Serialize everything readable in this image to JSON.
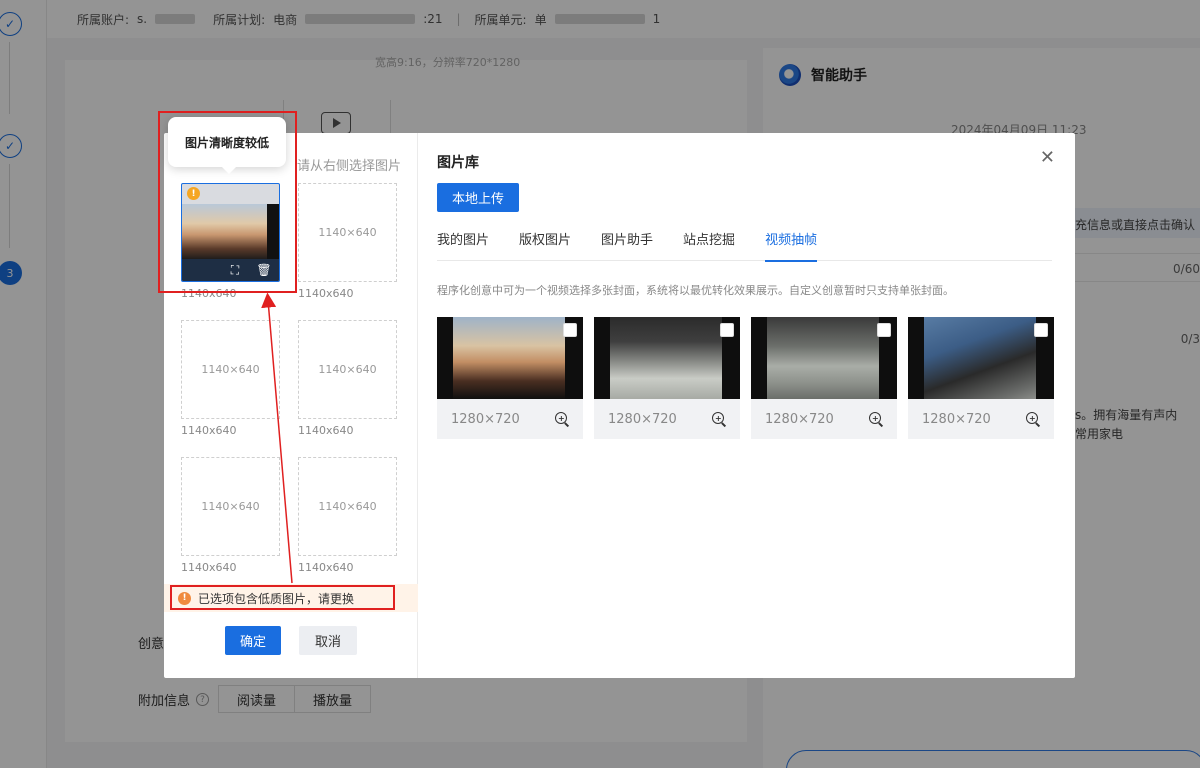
{
  "background": {
    "account_label": "所属账户:",
    "account_value": "s.",
    "plan_label": "所属计划:",
    "plan_value": "电商",
    "plan_suffix": ":21",
    "unit_label": "所属单元:",
    "unit_value": "单",
    "unit_suffix": "1",
    "video_info": "宽高9:16，分辨率720*1280",
    "step_3": "3",
    "creative_label": "创意",
    "extra_label": "附加信息",
    "extra_tags": [
      "阅读量",
      "播放量"
    ],
    "assistant_title": "智能助手",
    "assistant_date": "2024年04月09日 11:23",
    "assistant_hint": "充信息或直接点击确认",
    "assistant_counts": [
      "0/60",
      "0/3"
    ],
    "assistant_text_1": "s。拥有海量有声内",
    "assistant_text_2": "常用家电"
  },
  "left_pane": {
    "hint": "请从右侧选择图片",
    "tooltip": "图片清晰度较低",
    "slots": [
      {
        "label": "",
        "caption": "1140x640",
        "filled": true
      },
      {
        "label": "1140×640",
        "caption": "1140x640",
        "filled": false
      },
      {
        "label": "1140×640",
        "caption": "1140x640",
        "filled": false
      },
      {
        "label": "1140×640",
        "caption": "1140x640",
        "filled": false
      },
      {
        "label": "1140×640",
        "caption": "1140x640",
        "filled": false
      },
      {
        "label": "1140×640",
        "caption": "1140x640",
        "filled": false
      }
    ],
    "warning": "已选项包含低质图片，请更换",
    "confirm": "确定",
    "cancel": "取消"
  },
  "right_pane": {
    "title": "图片库",
    "upload": "本地上传",
    "tabs": [
      "我的图片",
      "版权图片",
      "图片助手",
      "站点挖掘",
      "视频抽帧"
    ],
    "active_tab": 4,
    "description": "程序化创意中可为一个视频选择多张封面，系统将以最优转化效果展示。自定义创意暂时只支持单张封面。",
    "frames": [
      {
        "size": "1280×720"
      },
      {
        "size": "1280×720"
      },
      {
        "size": "1280×720"
      },
      {
        "size": "1280×720"
      }
    ]
  },
  "colors": {
    "primary": "#1a6ee0",
    "warning": "#f08a3e",
    "annotation": "#e02020"
  }
}
